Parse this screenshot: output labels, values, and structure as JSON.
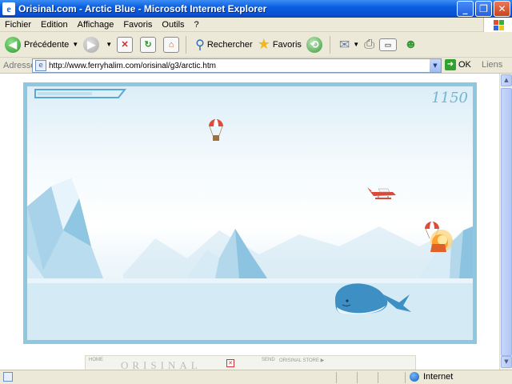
{
  "window": {
    "title": "Orisinal.com - Arctic Blue - Microsoft Internet Explorer",
    "minimize": "_",
    "maximize": "❐",
    "close": "✕"
  },
  "menu": [
    "Fichier",
    "Edition",
    "Affichage",
    "Favoris",
    "Outils",
    "?"
  ],
  "toolbar": {
    "back_label": "Précédente",
    "search_label": "Rechercher",
    "favorites_label": "Favoris"
  },
  "address": {
    "label": "Adresse",
    "url": "http://www.ferryhalim.com/orisinal/g3/arctic.htm",
    "go_label": "OK",
    "links_label": "Liens"
  },
  "game": {
    "score": "1150",
    "power_level": 0.65
  },
  "banner": {
    "home": "HOME",
    "logo": "ORISINAL",
    "send": "SEND",
    "store": "ORISINAL STORE ▶"
  },
  "status": {
    "zone": "Internet"
  },
  "colors": {
    "title_bar": "#0a5fe0",
    "game_border": "#8dc8e0",
    "whale": "#3e8fc4",
    "plane": "#d84a3a",
    "fire": "#ff8a1e"
  }
}
